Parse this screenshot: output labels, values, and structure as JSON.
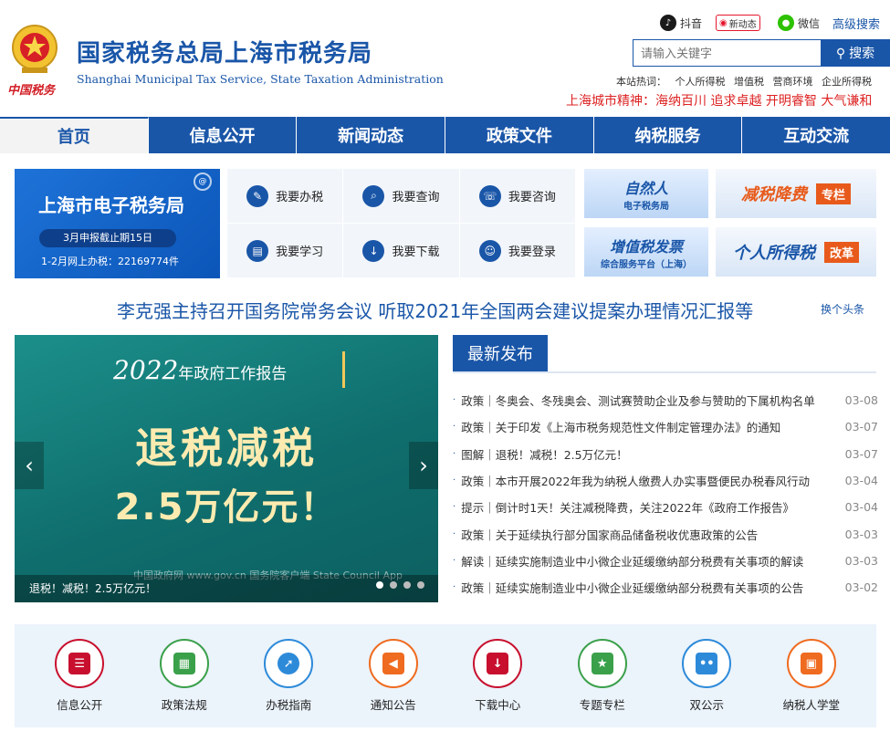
{
  "header": {
    "title": "国家税务总局上海市税务局",
    "subtitle": "Shanghai Municipal Tax Service, State Taxation Administration",
    "emblem_text": "中国税务",
    "social": [
      {
        "label": "抖音",
        "icon": "douyin-icon",
        "color": "#1a1a1a"
      },
      {
        "label": "新动态",
        "icon": "weibo-icon",
        "color": "#e6162d"
      },
      {
        "label": "微信",
        "icon": "wechat-icon",
        "color": "#2dc100"
      }
    ],
    "advanced_search": "高级搜索",
    "search_placeholder": "请输入关键字",
    "search_button": "搜索",
    "hot_label": "本站热词：",
    "hot_words": [
      "个人所得税",
      "增值税",
      "营商环境",
      "企业所得税"
    ],
    "city_spirit": "上海城市精神：海纳百川 追求卓越 开明睿智 大气谦和"
  },
  "nav": [
    "首页",
    "信息公开",
    "新闻动态",
    "政策文件",
    "纳税服务",
    "互动交流"
  ],
  "etax": {
    "title": "上海市电子税务局",
    "deadline": "3月申报截止期15日",
    "count": "1-2月网上办税：22169774件"
  },
  "quick_services": [
    {
      "label": "我要办税",
      "icon": "tax-filing-icon"
    },
    {
      "label": "我要查询",
      "icon": "query-icon"
    },
    {
      "label": "我要咨询",
      "icon": "consult-icon"
    },
    {
      "label": "我要学习",
      "icon": "study-icon"
    },
    {
      "label": "我要下载",
      "icon": "download-icon"
    },
    {
      "label": "我要登录",
      "icon": "login-icon"
    }
  ],
  "promos": {
    "natural_title": "自然人",
    "natural_sub": "电子税务局",
    "vat_title": "增值税发票",
    "vat_sub": "综合服务平台（上海）",
    "cut_title": "减税降费",
    "cut_tag": "专栏",
    "iit_title": "个人所得税",
    "iit_tag": "改革"
  },
  "headline": {
    "text": "李克强主持召开国务院常务会议 听取2021年全国两会建议提案办理情况汇报等",
    "switch": "换个头条"
  },
  "banner": {
    "year": "2022",
    "year_suffix": "年政府工作报告",
    "line1": "退税减税",
    "line2": "2.5万亿元！",
    "logos": "中国政府网 www.gov.cn      国务院客户端 State Council App",
    "caption": "退税！减税！2.5万亿元！",
    "slides": 4,
    "active_slide": 1
  },
  "news": {
    "tab": "最新发布",
    "items": [
      {
        "title": "政策｜冬奥会、冬残奥会、测试赛赞助企业及参与赞助的下属机构名单",
        "date": "03-08"
      },
      {
        "title": "政策｜关于印发《上海市税务规范性文件制定管理办法》的通知",
        "date": "03-07"
      },
      {
        "title": "图解｜退税！减税！2.5万亿元！",
        "date": "03-07"
      },
      {
        "title": "政策｜本市开展2022年我为纳税人缴费人办实事暨便民办税春风行动",
        "date": "03-04"
      },
      {
        "title": "提示｜倒计时1天！关注减税降费，关注2022年《政府工作报告》",
        "date": "03-04"
      },
      {
        "title": "政策｜关于延续执行部分国家商品储备税收优惠政策的公告",
        "date": "03-03"
      },
      {
        "title": "解读｜延续实施制造业中小微企业延缓缴纳部分税费有关事项的解读",
        "date": "03-03"
      },
      {
        "title": "政策｜延续实施制造业中小微企业延缓缴纳部分税费有关事项的公告",
        "date": "03-02"
      }
    ]
  },
  "bottom_links": [
    {
      "label": "信息公开",
      "icon": "info-list-icon",
      "color": "#c8102e"
    },
    {
      "label": "政策法规",
      "icon": "policy-book-icon",
      "color": "#3aa04a"
    },
    {
      "label": "办税指南",
      "icon": "compass-icon",
      "color": "#2d8ad9"
    },
    {
      "label": "通知公告",
      "icon": "speaker-icon",
      "color": "#ef6b1f"
    },
    {
      "label": "下载中心",
      "icon": "download-box-icon",
      "color": "#c8102e"
    },
    {
      "label": "专题专栏",
      "icon": "topic-list-icon",
      "color": "#3aa04a"
    },
    {
      "label": "双公示",
      "icon": "robot-icon",
      "color": "#2d8ad9"
    },
    {
      "label": "纳税人学堂",
      "icon": "classroom-icon",
      "color": "#ef6b1f"
    }
  ]
}
